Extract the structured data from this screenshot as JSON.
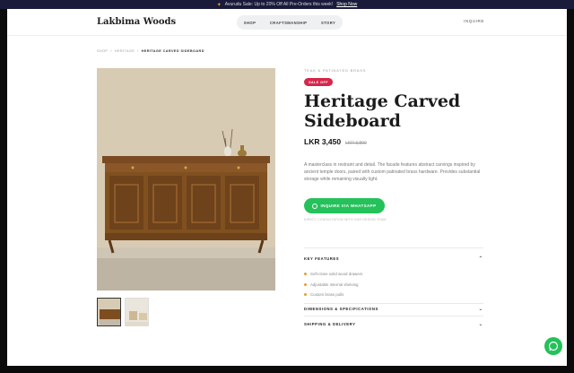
{
  "promo": {
    "text": "Avurudu Sale: Up to 20% Off All Pre-Orders this week!",
    "link": "Shop Now"
  },
  "header": {
    "logo": "Lakbima Woods",
    "nav": [
      "SHOP",
      "CRAFTSMANSHIP",
      "STORY"
    ],
    "inquire": "INQUIRE"
  },
  "breadcrumb": [
    "SHOP",
    "/",
    "HERITAGE",
    "/",
    "HERITAGE CARVED SIDEBOARD"
  ],
  "product": {
    "category": "TEAK & PATINATED BRASS",
    "badge": "SALE OFF",
    "title": "Heritage Carved Sideboard",
    "price": "LKR 3,450",
    "old_price": "LKR 3,800",
    "description": "A masterclass in restraint and detail. The facade features abstract carvings inspired by ancient temple doors, paired with custom patinated brass hardware. Provides substantial storage while remaining visually light.",
    "cta": "INQUIRE VIA WHATSAPP",
    "cta_note": "DIRECT CONSULTATION WITH OUR DESIGN TEAM"
  },
  "accordion": {
    "features_title": "KEY FEATURES",
    "features": [
      "Soft-close solid wood drawers",
      "Adjustable internal shelving",
      "Custom brass pulls"
    ],
    "dimensions_title": "DIMENSIONS & SPECIFICATIONS",
    "shipping_title": "SHIPPING & DELIVERY"
  },
  "colors": {
    "accent": "#25c15a",
    "badge": "#d6264a",
    "promo_bg": "#1a1b3a",
    "bullet": "#e0a030"
  }
}
